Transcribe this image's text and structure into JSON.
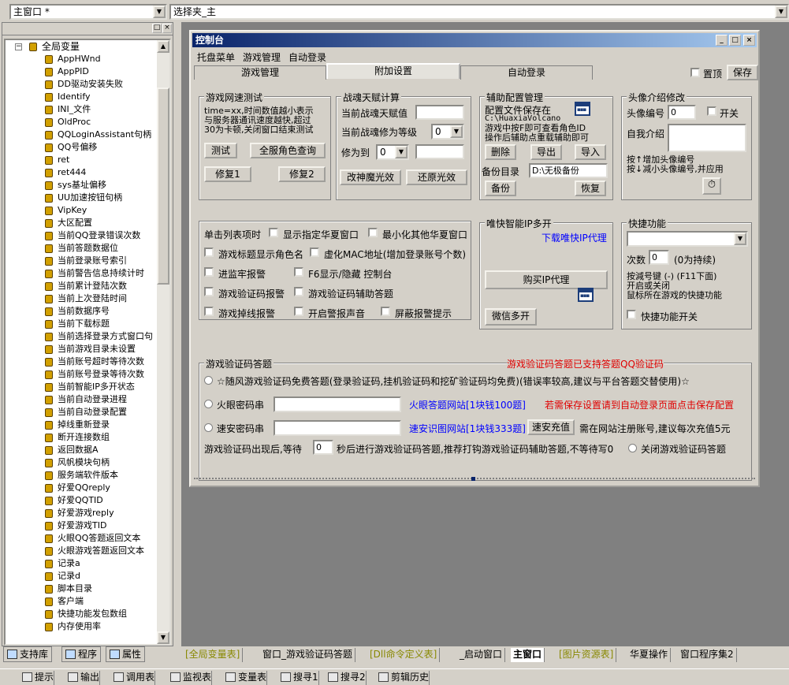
{
  "top": {
    "window_combo": "主窗口 *",
    "folder_combo": "选择夹_主"
  },
  "tree": {
    "root": "全局变量",
    "items": [
      "AppHWnd",
      "AppPID",
      "DD驱动安装失败",
      "Identify",
      "INI_文件",
      "OldProc",
      "QQLoginAssistant句柄",
      "QQ号偏移",
      "ret",
      "ret444",
      "sys基址偏移",
      "UU加速按钮句柄",
      "VipKey",
      "大区配置",
      "当前QQ登录错误次数",
      "当前答题数据位",
      "当前登录账号索引",
      "当前警告信息持续计时",
      "当前累计登陆次数",
      "当前上次登陆时间",
      "当前数据序号",
      "当前下载标题",
      "当前选择登录方式窗口句",
      "当前游戏目录未设置",
      "当前账号超时等待次数",
      "当前账号登录等待次数",
      "当前智能IP多开状态",
      "当前自动登录进程",
      "当前自动登录配置",
      "掉线重新登录",
      "断开连接数组",
      "返回数据A",
      "风帆模块句柄",
      "服务端软件版本",
      "好爱QQreply",
      "好爱QQTID",
      "好爱游戏reply",
      "好爱游戏TID",
      "火眼QQ答题返回文本",
      "火眼游戏答题返回文本",
      "记录a",
      "记录d",
      "脚本目录",
      "客户端",
      "快捷功能发包数组",
      "内存使用率"
    ]
  },
  "left_tabs": [
    "支持库",
    "程序",
    "属性"
  ],
  "window": {
    "title": "控制台",
    "menu": [
      "托盘菜单",
      "游戏管理",
      "自动登录"
    ],
    "tabs": [
      "游戏管理",
      "附加设置",
      "自动登录"
    ],
    "pin_label": "置顶",
    "save_label": "保存",
    "speed": {
      "title": "游戏网速测试",
      "desc": [
        "time=xx,时间数值越小表示",
        "与服务器通讯速度越快,超过",
        "30为卡顿,关闭窗口结束测试"
      ],
      "btn_test": "测试",
      "btn_query": "全服角色查询",
      "btn_fix1": "修复1",
      "btn_fix2": "修复2"
    },
    "zhanhun": {
      "title": "战魂天赋计算",
      "label_current": "当前战魂天赋值",
      "label_level": "当前战魂修为等级",
      "level_value": "0",
      "label_to": "修为到",
      "to_value": "0",
      "btn_change": "改神魔光效",
      "btn_restore": "还原光效"
    },
    "aux": {
      "title": "辅助配置管理",
      "label_path": "配置文件保存在",
      "path": "C:\\HuaxiaVolcano",
      "note1": "游戏中按F即可查看角色ID",
      "note2": "操作后辅助点重载辅助即可",
      "btn_delete": "删除",
      "btn_export": "导出",
      "btn_import": "导入",
      "label_backup": "备份目录",
      "backup_dir": "D:\\无极备份",
      "btn_backup": "备份",
      "btn_restore": "恢复"
    },
    "avatar": {
      "title": "头像介绍修改",
      "label_num": "头像编号",
      "num_value": "0",
      "switch_label": "开关",
      "label_intro": "自我介绍",
      "hint1": "按↑增加头像编号",
      "hint2": "按↓减小头像编号,并应用"
    },
    "options": {
      "label_click": "单击列表项时",
      "show_window": "显示指定华夏窗口",
      "minimize_other": "最小化其他华夏窗口",
      "title_role": "游戏标题显示角色名",
      "virtual_mac": "虚化MAC地址(增加登录账号个数)",
      "jail_alarm": "进监牢报警",
      "f6_toggle": "F6显示/隐藏 控制台",
      "captcha_alarm": "游戏验证码报警",
      "captcha_assist": "游戏验证码辅助答题",
      "disconnect_alarm": "游戏掉线报警",
      "alarm_sound": "开启警报声音",
      "block_alarm": "屏蔽报警提示"
    },
    "ip": {
      "title": "唯快智能IP多开",
      "download_link": "下载唯快IP代理",
      "btn_buy": "购买IP代理",
      "btn_wechat": "微信多开"
    },
    "shortcut": {
      "title": "快捷功能",
      "label_times": "次数",
      "times_value": "0",
      "times_note": "(0为持续)",
      "note1": "按減号键 (-) (F11下面)",
      "note2": "开启或关闭",
      "note3": "鼠标所在游戏的快捷功能",
      "switch_label": "快捷功能开关"
    },
    "captcha": {
      "title": "游戏验证码答题",
      "notice": "游戏验证码答题已支持答题QQ验证码",
      "opt_free": "☆随风游戏验证码免费答题(登录验证码,挂机验证码和挖矿验证码均免费)(错误率较高,建议与平台答题交替使用)☆",
      "label_huoyan": "火眼密码串",
      "huoyan_link": "火眼答题网站[1块钱100题]",
      "save_hint": "若需保存设置请到自动登录页面点击保存配置",
      "label_suan": "速安密码串",
      "suan_link": "速安识图网站[1块钱333题]",
      "btn_recharge": "速安充值",
      "recharge_hint": "需在网站注册账号,建议每次充值5元",
      "wait_prefix": "游戏验证码出现后,等待",
      "wait_value": "0",
      "wait_suffix": "秒后进行游戏验证码答题,推荐打钩游戏验证码辅助答题,不等待写0",
      "opt_close": "关闭游戏验证码答题"
    }
  },
  "doc_tabs": [
    "[全局变量表]",
    "窗口_游戏验证码答题",
    "[Dll命令定义表]",
    "_启动窗口",
    "主窗口",
    "[图片资源表]",
    "华夏操作",
    "窗口程序集2"
  ],
  "status_tabs": [
    "提示",
    "输出",
    "调用表",
    "监视表",
    "变量表",
    "搜寻1",
    "搜寻2",
    "剪辑历史"
  ]
}
